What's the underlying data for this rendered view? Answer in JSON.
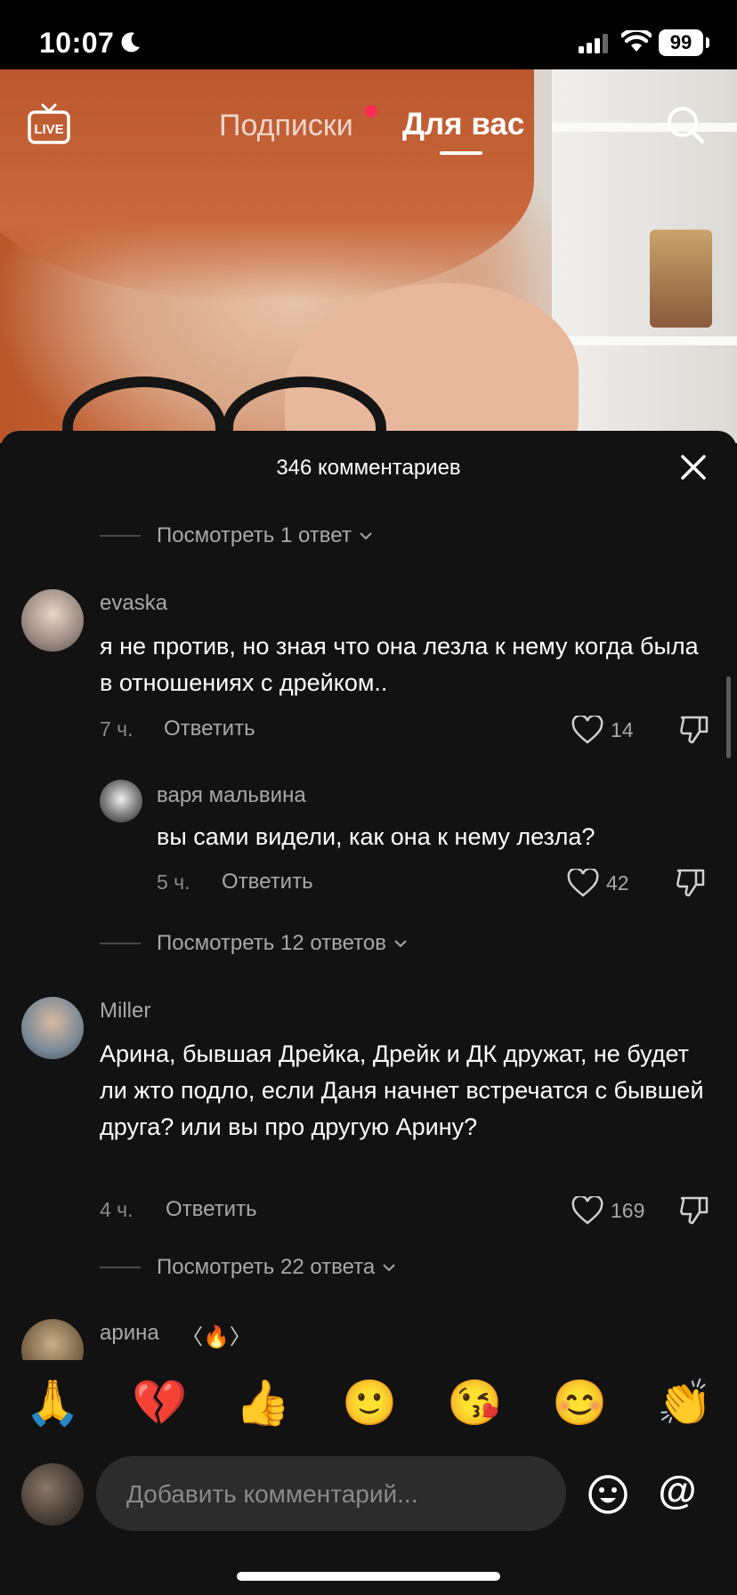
{
  "status_bar": {
    "time": "10:07",
    "battery": "99"
  },
  "top_nav": {
    "following": "Подписки",
    "for_you": "Для вас"
  },
  "comments": {
    "count_title": "346 комментариев",
    "view_1": "Посмотреть 1 ответ",
    "c1": {
      "author": "evaska",
      "text": "я не против, но зная что она лезла к нему когда была в отношениях с дрейком..",
      "time": "7 ч.",
      "reply": "Ответить",
      "likes": "14"
    },
    "r1": {
      "author": "варя мальвина",
      "text": "вы сами видели, как она к нему лезла?",
      "time": "5 ч.",
      "reply": "Ответить",
      "likes": "42"
    },
    "view_2": "Посмотреть 12 ответов",
    "c2": {
      "author": "Miller",
      "text": "Арина, бывшая Дрейка, Дрейк и ДК дружат, не будет ли жто подло, если Даня начнет встречатся с бывшей друга? или вы про другую Арину?",
      "time": "4 ч.",
      "reply": "Ответить",
      "likes": "169"
    },
    "view_3": "Посмотреть 22 ответа",
    "c3": {
      "author": "арина",
      "badge": "〈🔥〉"
    }
  },
  "emoji_bar": [
    "🙏",
    "💔",
    "👍",
    "🙂",
    "😘",
    "😊",
    "👏"
  ],
  "input": {
    "placeholder": "Добавить комментарий...",
    "mention": "@"
  },
  "colors": {
    "accent": "#fe2c55",
    "sheet_bg": "#121212"
  }
}
